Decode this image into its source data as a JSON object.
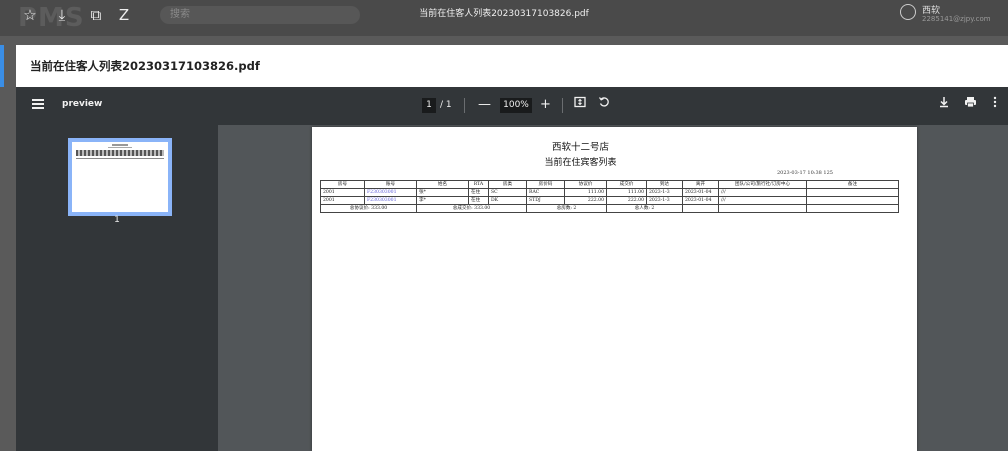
{
  "browser": {
    "logo": "PMS",
    "search_placeholder": "搜索",
    "doc_title": "当前在住客人列表20230317103826.pdf",
    "user_name": "西软",
    "user_sub": "2285141@zjpy.com"
  },
  "modal": {
    "title": "当前在住客人列表20230317103826.pdf"
  },
  "toolbar": {
    "file_name": "preview",
    "current_page": "1",
    "page_separator": "/",
    "total_pages": "1",
    "zoom": "100%",
    "zoom_out": "—",
    "zoom_in": "+"
  },
  "sidebar": {
    "thumbnail_label": "1"
  },
  "report": {
    "hotel_name": "西软十二号店",
    "report_title": "当前在住宾客列表",
    "print_stamp": "2023-03-17 10:38  125",
    "headers": [
      "房号",
      "账号",
      "姓名",
      "RTA",
      "房类",
      "房价码",
      "协议价",
      "成交价",
      "到达",
      "离开",
      "团队/公司/旅行社/订房中心",
      "备注"
    ],
    "rows": [
      [
        "2001",
        "F230303001",
        "张*",
        "在住",
        "SC",
        "RAC",
        "111.00",
        "111.00",
        "2023-1-3",
        "2023-01-04",
        "///",
        ""
      ],
      [
        "2001",
        "F230303001",
        "李*",
        "在住",
        "DK",
        "STDJ",
        "222.00",
        "222.00",
        "2023-1-3",
        "2023-01-04",
        "///",
        ""
      ]
    ],
    "footer": {
      "total_protocol": "总协议价: 333.00",
      "total_deal": "总成交价: 333.00",
      "total_rooms": "总房数: 2",
      "total_people": "总人数: 2"
    }
  }
}
